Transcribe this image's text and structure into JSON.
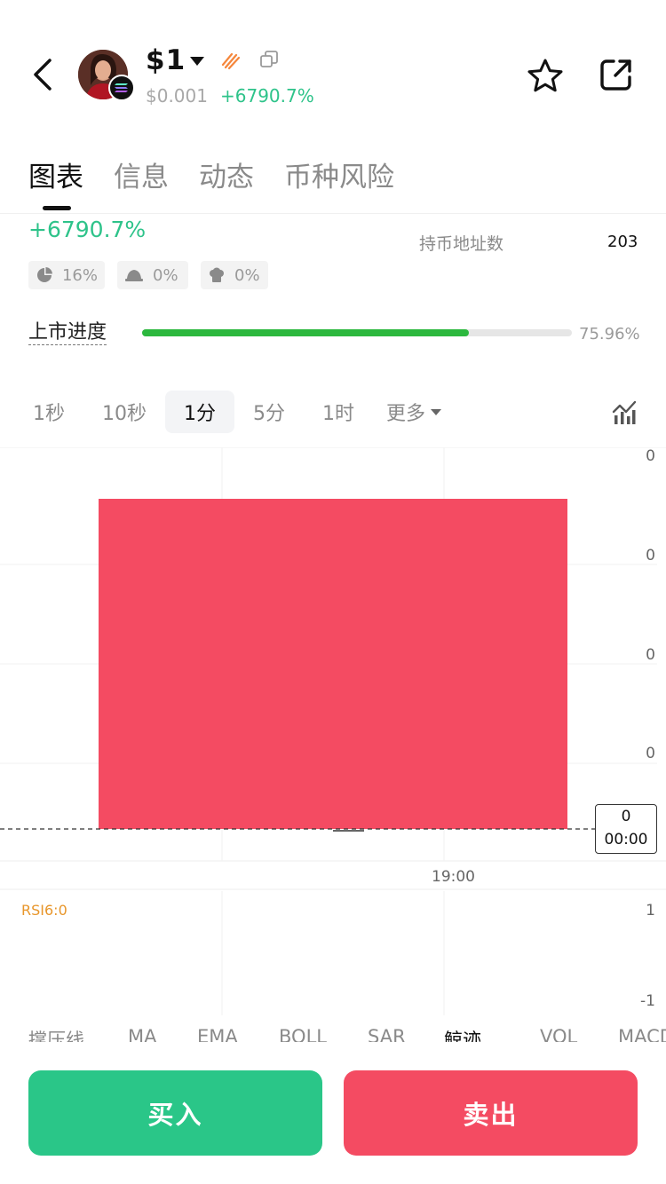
{
  "header": {
    "title": "$1",
    "price": "$0.001",
    "change": "+6790.7%"
  },
  "tabs": [
    {
      "label": "图表"
    },
    {
      "label": "信息"
    },
    {
      "label": "动态"
    },
    {
      "label": "币种风险"
    }
  ],
  "stats": {
    "change": "+6790.7%",
    "holders_label": "持币地址数",
    "holders_value": "203",
    "chips": [
      "16%",
      "0%",
      "0%"
    ]
  },
  "progress": {
    "label": "上市进度",
    "percent_text": "75.96%",
    "fraction": 0.7596,
    "fill_color": "#2cb83e"
  },
  "intervals": {
    "items": [
      "1秒",
      "10秒",
      "1分",
      "5分",
      "1时"
    ],
    "active": "1分",
    "more": "更多"
  },
  "chart": {
    "y_labels": [
      "0",
      "0",
      "0",
      "0"
    ],
    "price_tag_value": "0",
    "price_tag_time": "00:00",
    "x_label": "19:00",
    "candle_color": "#f44b62"
  },
  "rsi": {
    "label": "RSI6:0",
    "high": "1",
    "low": "-1"
  },
  "indicator_tabs": [
    "撑压线",
    "MA",
    "EMA",
    "BOLL",
    "SAR",
    "鲸迹",
    "VOL",
    "MACD"
  ],
  "buttons": {
    "buy": "买入",
    "sell": "卖出"
  },
  "colors": {
    "up": "#2ec38a",
    "down": "#f44b62"
  }
}
